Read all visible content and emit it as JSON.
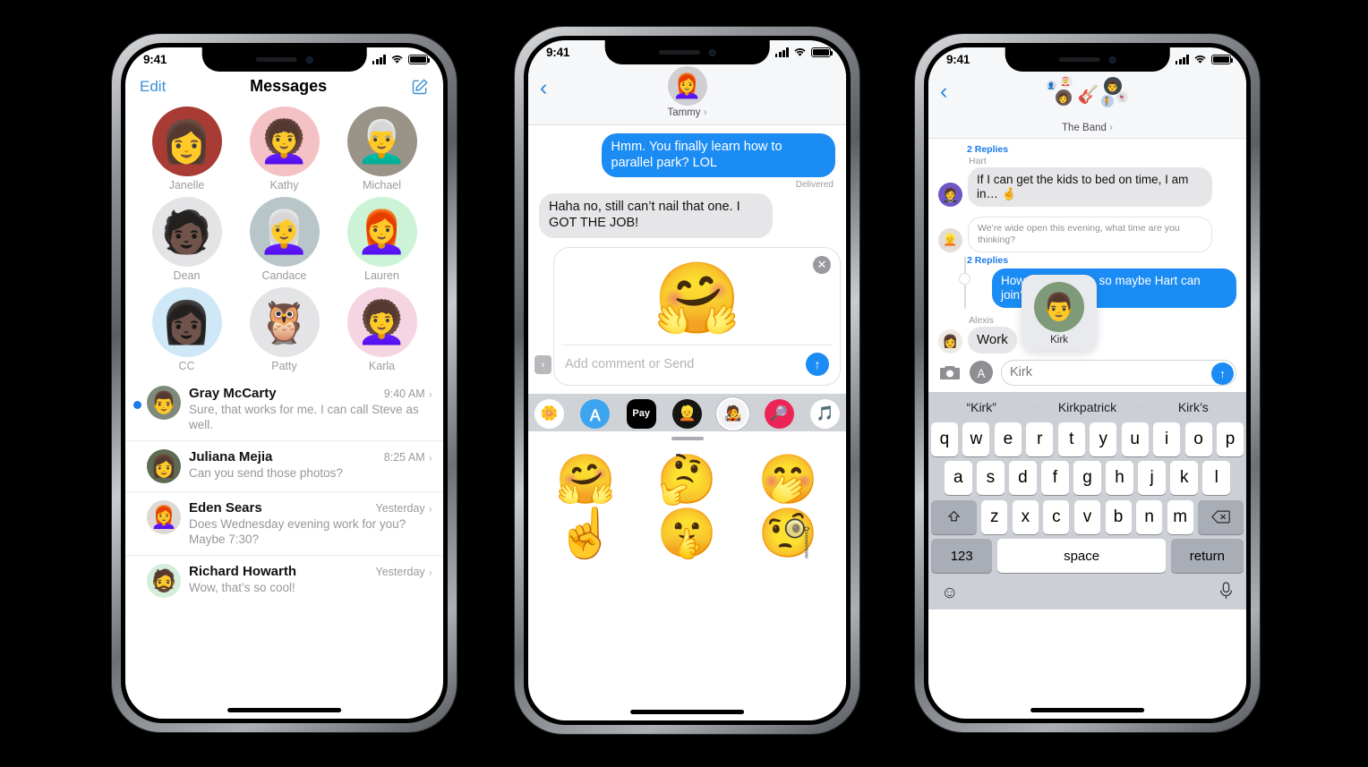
{
  "phones": {
    "phone1": {
      "status": {
        "time": "9:41",
        "signal": "cellular-bars",
        "wifi": "wifi-icon",
        "battery": "battery-full"
      },
      "nav": {
        "edit_label": "Edit",
        "title": "Messages",
        "compose_icon": "compose-icon"
      },
      "contacts": [
        {
          "name": "Janelle",
          "type": "photo",
          "bg": "#a83c35",
          "glyph": "👩"
        },
        {
          "name": "Kathy",
          "type": "memoji",
          "bg": "#f4c2c5",
          "glyph": "👩‍🦱"
        },
        {
          "name": "Michael",
          "type": "photo",
          "bg": "#9a9488",
          "glyph": "👨‍🦳"
        },
        {
          "name": "Dean",
          "type": "memoji",
          "bg": "#e4e4e6",
          "glyph": "🧑🏿"
        },
        {
          "name": "Candace",
          "type": "photo",
          "bg": "#b9c6c9",
          "glyph": "👩‍🦳"
        },
        {
          "name": "Lauren",
          "type": "memoji",
          "bg": "#cdf3d7",
          "glyph": "👩‍🦰"
        },
        {
          "name": "CC",
          "type": "memoji",
          "bg": "#cfe8f7",
          "glyph": "👩🏿"
        },
        {
          "name": "Patty",
          "type": "memoji",
          "bg": "#e4e4e6",
          "glyph": "🦉"
        },
        {
          "name": "Karla",
          "type": "memoji",
          "bg": "#f6d5e2",
          "glyph": "👩‍🦱"
        }
      ],
      "conversations": [
        {
          "name": "Gray McCarty",
          "time": "9:40 AM",
          "preview": "Sure, that works for me. I can call Steve as well.",
          "unread": true,
          "bg": "#7f8a7a",
          "glyph": "👨"
        },
        {
          "name": "Juliana Mejia",
          "time": "8:25 AM",
          "preview": "Can you send those photos?",
          "unread": false,
          "bg": "#5d6b53",
          "glyph": "👩"
        },
        {
          "name": "Eden Sears",
          "time": "Yesterday",
          "preview": "Does Wednesday evening work for you? Maybe 7:30?",
          "unread": false,
          "bg": "#ddd8d4",
          "glyph": "👩‍🦰"
        },
        {
          "name": "Richard Howarth",
          "time": "Yesterday",
          "preview": "Wow, that’s so cool!",
          "unread": false,
          "bg": "#d3eeda",
          "glyph": "🧔"
        }
      ]
    },
    "phone2": {
      "status": {
        "time": "9:41"
      },
      "header": {
        "back_icon": "back-chevron-icon",
        "contact_name": "Tammy",
        "chevron": "›",
        "avatar_bg": "#cfcfd2",
        "avatar_glyph": "👩‍🦰"
      },
      "messages": [
        {
          "side": "out",
          "text": "Hmm. You finally learn how to parallel park? LOL"
        },
        {
          "side": "in",
          "text": "Haha no, still can’t nail that one. I GOT THE JOB!"
        }
      ],
      "delivered_label": "Delivered",
      "sticker_card": {
        "close_icon": "close-icon",
        "sticker_glyph": "🤗",
        "comment_placeholder": "Add comment or Send",
        "send_icon": "send-arrow-icon",
        "expand_icon": "expand-chevron-icon"
      },
      "app_drawer": [
        {
          "name": "photos-app",
          "bg": "#ffffff",
          "glyph": "🌼",
          "selected": false
        },
        {
          "name": "app-store-app",
          "bg": "#3da5ef",
          "glyph": "Ａ",
          "selected": false
        },
        {
          "name": "apple-pay-app",
          "bg": "#000000",
          "glyph": "Pay",
          "selected": false
        },
        {
          "name": "memoji-app",
          "bg": "#171512",
          "glyph": "👱",
          "selected": false
        },
        {
          "name": "stickers-app",
          "bg": "#f2f2f4",
          "glyph": "🧑‍🎤",
          "selected": true
        },
        {
          "name": "images-app",
          "bg": "#ec2556",
          "glyph": "🔎",
          "selected": false
        },
        {
          "name": "music-app",
          "bg": "#ffffff",
          "glyph": "🎵",
          "selected": false
        }
      ],
      "sticker_grid": [
        "🤗",
        "🤔",
        "🤭",
        "☝️",
        "🤫",
        "🧐"
      ]
    },
    "phone3": {
      "status": {
        "time": "9:41"
      },
      "header": {
        "back_icon": "back-chevron-icon",
        "group_name": "The Band",
        "chevron": "›",
        "center_glyph": "🎸",
        "center_bg": "#d3f0d9"
      },
      "thread": {
        "replies_label_1": "2 Replies",
        "sender_hart": "Hart",
        "msg_hart": "If I can get the kids to bed on time, I am in… 🤞",
        "msg_ghost": "We’re wide open this evening, what time are you thinking?",
        "replies_label_2": "2 Replies",
        "msg_out": "How about 8 p.m. so maybe Hart can join?",
        "sender_alexis": "Alexis",
        "msg_alexis": "Work"
      },
      "mention_popover": {
        "name": "Kirk",
        "avatar_glyph": "👨"
      },
      "input": {
        "camera_icon": "camera-icon",
        "apps_icon": "apps-icon",
        "value": "Kirk",
        "send_icon": "send-arrow-icon"
      },
      "keyboard": {
        "predictions": [
          "“Kirk”",
          "Kirkpatrick",
          "Kirk’s"
        ],
        "row1": [
          "q",
          "w",
          "e",
          "r",
          "t",
          "y",
          "u",
          "i",
          "o",
          "p"
        ],
        "row2": [
          "a",
          "s",
          "d",
          "f",
          "g",
          "h",
          "j",
          "k",
          "l"
        ],
        "row3": [
          "z",
          "x",
          "c",
          "v",
          "b",
          "n",
          "m"
        ],
        "shift_icon": "shift-icon",
        "backspace_icon": "backspace-icon",
        "numeric_label": "123",
        "space_label": "space",
        "return_label": "return",
        "emoji_icon": "emoji-icon",
        "mic_icon": "microphone-icon"
      }
    }
  },
  "colors": {
    "imessage_blue": "#1b8cf4",
    "bubble_gray": "#e6e6e9",
    "link_blue": "#3d8fd6",
    "unread_dot": "#1a7ae8"
  }
}
